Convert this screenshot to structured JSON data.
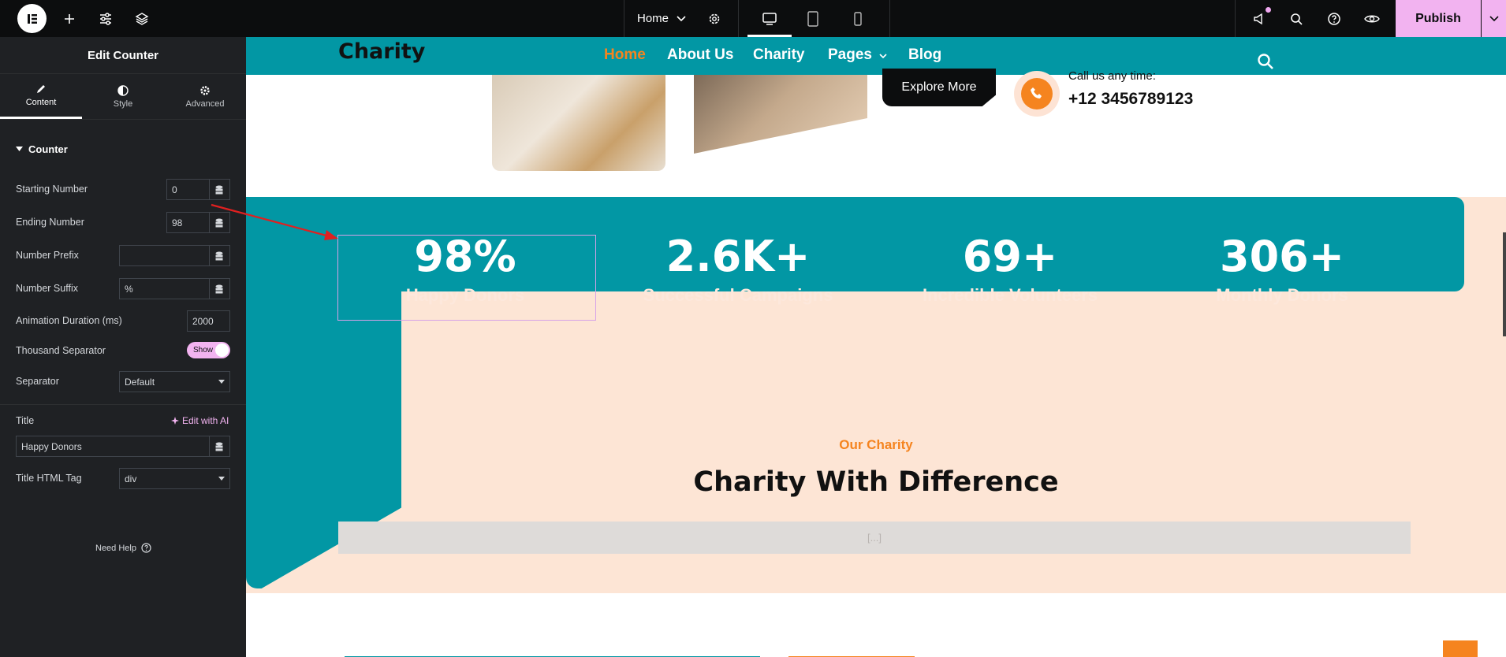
{
  "topbar": {
    "page_name": "Home",
    "publish_label": "Publish"
  },
  "panel": {
    "title": "Edit Counter",
    "tabs": [
      {
        "label": "Content",
        "icon": "pencil-icon"
      },
      {
        "label": "Style",
        "icon": "half-circle-icon"
      },
      {
        "label": "Advanced",
        "icon": "gear-icon"
      }
    ],
    "section": "Counter",
    "starting_number_label": "Starting Number",
    "starting_number_value": "0",
    "ending_number_label": "Ending Number",
    "ending_number_value": "98",
    "prefix_label": "Number Prefix",
    "prefix_value": "",
    "suffix_label": "Number Suffix",
    "suffix_value": "%",
    "duration_label": "Animation Duration (ms)",
    "duration_value": "2000",
    "separator_toggle_label": "Thousand Separator",
    "separator_toggle_value": "Show",
    "separator_label": "Separator",
    "separator_value": "Default",
    "title_label": "Title",
    "edit_ai_label": "Edit with AI",
    "title_value": "Happy Donors",
    "title_tag_label": "Title HTML Tag",
    "title_tag_value": "div",
    "need_help": "Need Help"
  },
  "site": {
    "brand": "Charity",
    "nav": [
      "Home",
      "About Us",
      "Charity",
      "Pages",
      "Blog"
    ],
    "explore_label": "Explore More",
    "call_label": "Call us any time:",
    "call_number": "+12 3456789123",
    "stats": [
      {
        "number": "98%",
        "title": "Happy Donors"
      },
      {
        "number": "2.6K+",
        "title": "Successful Campaigns"
      },
      {
        "number": "69+",
        "title": "Incredible Volunteers"
      },
      {
        "number": "306+",
        "title": "Monthly Donors"
      }
    ],
    "eyebrow": "Our Charity",
    "heading": "Charity With Difference",
    "placeholder": "[...]"
  },
  "colors": {
    "teal": "#0297a4",
    "orange": "#f5841f",
    "peach": "#fde5d5",
    "publish": "#f2b3f0",
    "panel_bg": "#1f2124"
  }
}
